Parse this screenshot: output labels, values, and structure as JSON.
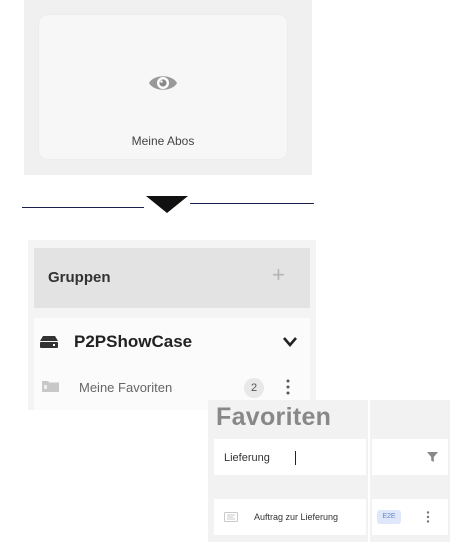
{
  "abos_card": {
    "label": "Meine Abos",
    "icon": "eye-icon"
  },
  "divider": {
    "icon": "arrow-down-icon"
  },
  "gruppen": {
    "title": "Gruppen",
    "add_icon": "plus-icon",
    "group": {
      "name": "P2PShowCase",
      "icon": "drive-icon",
      "expand_icon": "chevron-down-icon"
    },
    "favorites": {
      "label": "Meine Favoriten",
      "count": "2",
      "icon": "folder-icon",
      "menu_icon": "kebab-menu-icon"
    }
  },
  "favoriten": {
    "title": "Favoriten",
    "search": {
      "value": "Lieferung"
    },
    "filter_icon": "filter-icon",
    "items": [
      {
        "label": "Auftrag zur Lieferung",
        "badge": "E2E",
        "icon": "route-icon",
        "menu_icon": "kebab-menu-icon"
      }
    ]
  },
  "colors": {
    "accent_badge": "#dfe8fb",
    "divider_line": "#1a1f4d"
  }
}
